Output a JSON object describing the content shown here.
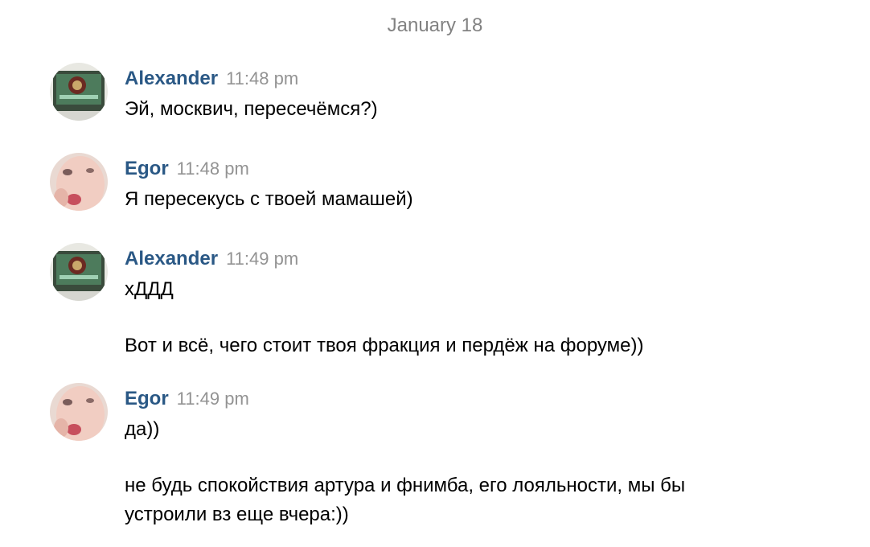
{
  "date_separator": "January 18",
  "messages": [
    {
      "author": "Alexander",
      "avatar": "alexander-avatar",
      "time": "11:48 pm",
      "lines": [
        "Эй, москвич, пересечёмся?)"
      ]
    },
    {
      "author": "Egor",
      "avatar": "egor-avatar",
      "time": "11:48 pm",
      "lines": [
        "Я пересекусь с твоей мамашей)"
      ]
    },
    {
      "author": "Alexander",
      "avatar": "alexander-avatar",
      "time": "11:49 pm",
      "lines": [
        "хДДД",
        "Вот и всё, чего стоит твоя фракция и пердёж на форуме))"
      ]
    },
    {
      "author": "Egor",
      "avatar": "egor-avatar",
      "time": "11:49 pm",
      "lines": [
        "да))",
        "не будь спокойствия артура и фнимба, его лояльности, мы бы устроили вз еще вчера:))"
      ]
    }
  ],
  "colors": {
    "author": "#2a5885",
    "time": "#939393",
    "date": "#828282"
  }
}
